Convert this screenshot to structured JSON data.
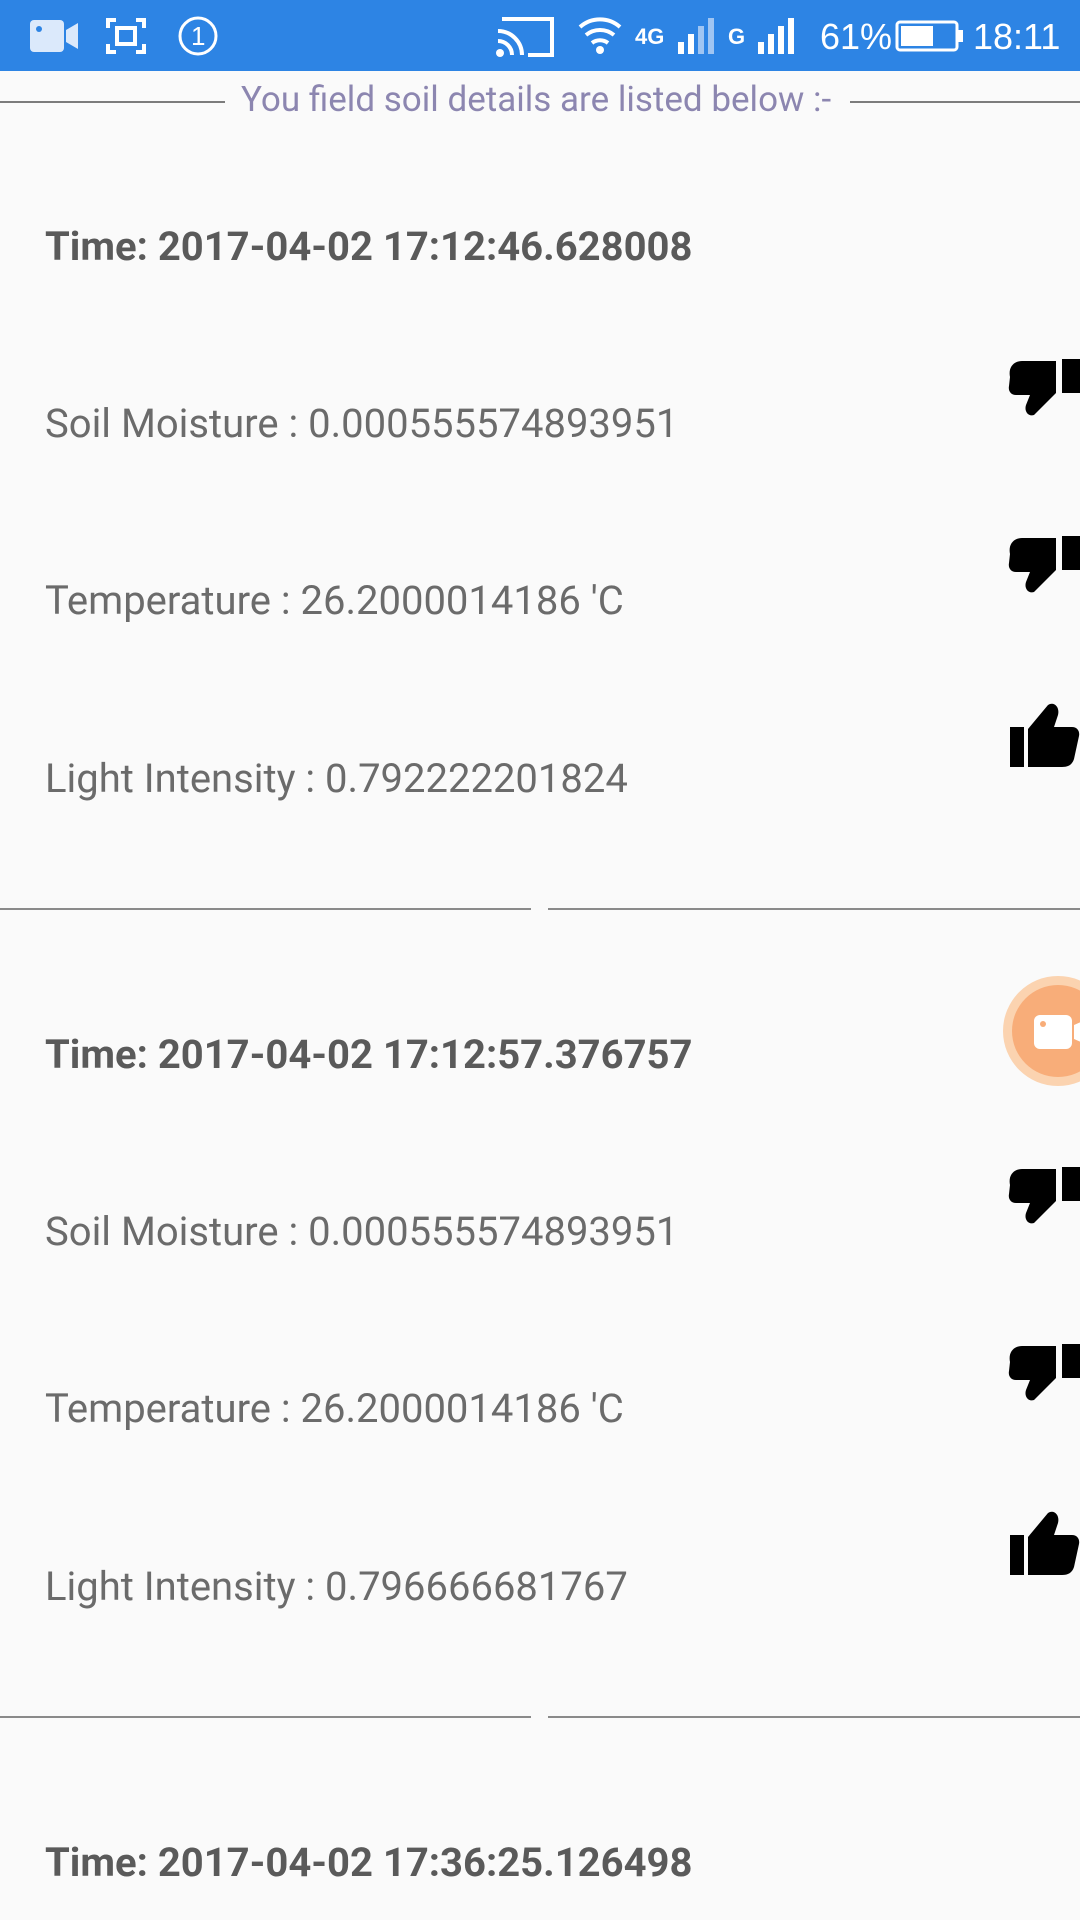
{
  "status_bar": {
    "icons_left": [
      "video-camera-icon",
      "screenshot-frame-icon",
      "notification-count-icon"
    ],
    "notification_count": "1",
    "icons_right": [
      "cast-icon",
      "wifi-icon",
      "signal-4g-icon",
      "signal-g-icon",
      "battery-icon"
    ],
    "network_4g": "4G",
    "network_g": "G",
    "battery": "61%",
    "battery_level": 0.61,
    "time": "18:11"
  },
  "header": {
    "text": "You field soil details are listed below :-"
  },
  "records": [
    {
      "time": "Time: 2017-04-02 17:12:46.628008",
      "soil_moisture": "Soil Moisture : 0.000555574893951",
      "soil_icon": "thumbs-down-icon",
      "temperature": "Temperature : 26.2000014186 'C",
      "temp_icon": "thumbs-down-icon",
      "light_intensity": "Light Intensity : 0.792222201824",
      "light_icon": "thumbs-up-icon"
    },
    {
      "time": "Time: 2017-04-02 17:12:57.376757",
      "soil_moisture": "Soil Moisture : 0.000555574893951",
      "soil_icon": "thumbs-down-icon",
      "temperature": "Temperature : 26.2000014186 'C",
      "temp_icon": "thumbs-down-icon",
      "light_intensity": "Light Intensity : 0.796666681767",
      "light_icon": "thumbs-up-icon"
    },
    {
      "time": "Time: 2017-04-02 17:36:25.126498"
    }
  ],
  "fab": {
    "icon": "video-camera-icon",
    "color": "#f8ad79"
  },
  "colors": {
    "status_bar": "#2d84e4",
    "header_text": "#8c86b0",
    "background": "#fafafa"
  }
}
